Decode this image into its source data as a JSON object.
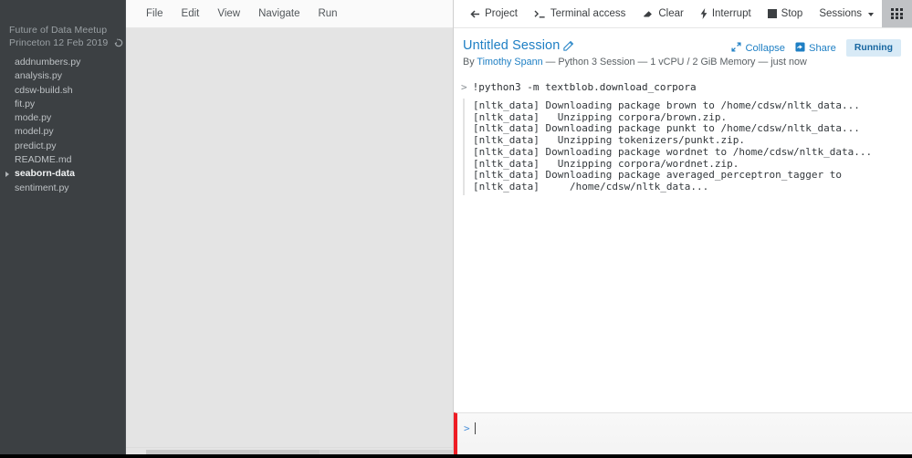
{
  "sidebar": {
    "project_title_line1": "Future of Data Meetup",
    "project_title_line2": "Princeton 12 Feb 2019",
    "refresh_icon": "refresh-icon",
    "files": [
      {
        "name": "addnumbers.py",
        "type": "file"
      },
      {
        "name": "analysis.py",
        "type": "file"
      },
      {
        "name": "cdsw-build.sh",
        "type": "file"
      },
      {
        "name": "fit.py",
        "type": "file"
      },
      {
        "name": "mode.py",
        "type": "file"
      },
      {
        "name": "model.py",
        "type": "file"
      },
      {
        "name": "predict.py",
        "type": "file"
      },
      {
        "name": "README.md",
        "type": "file"
      },
      {
        "name": "seaborn-data",
        "type": "folder"
      },
      {
        "name": "sentiment.py",
        "type": "file"
      }
    ]
  },
  "menubar": {
    "items": [
      {
        "label": "File"
      },
      {
        "label": "Edit"
      },
      {
        "label": "View"
      },
      {
        "label": "Navigate"
      },
      {
        "label": "Run"
      }
    ]
  },
  "toolbar": {
    "items": [
      {
        "label": "Project",
        "icon": "arrow-left-icon"
      },
      {
        "label": "Terminal access",
        "icon": "terminal-icon"
      },
      {
        "label": "Clear",
        "icon": "eraser-icon"
      },
      {
        "label": "Interrupt",
        "icon": "lightning-icon"
      },
      {
        "label": "Stop",
        "icon": "stop-square-icon"
      },
      {
        "label": "Sessions",
        "icon": "chevron-down-icon"
      }
    ],
    "apps_icon": "grid-apps-icon"
  },
  "session": {
    "title": "Untitled Session",
    "edit_icon": "pencil-edit-icon",
    "by_label": "By",
    "author": "Timothy Spann",
    "meta": "— Python 3 Session — 1 vCPU / 2 GiB Memory — just now",
    "collapse_label": "Collapse",
    "collapse_icon": "collapse-arrows-icon",
    "share_label": "Share",
    "share_icon": "share-icon",
    "status_badge": "Running",
    "accent_color": "#1e7fc4",
    "badge_bg": "#d8eaf6",
    "badge_fg": "#1766a0"
  },
  "console": {
    "prompt_symbol": ">",
    "command": "!python3 -m textblob.download_corpora",
    "output_lines": [
      "[nltk_data] Downloading package brown to /home/cdsw/nltk_data...",
      "[nltk_data]   Unzipping corpora/brown.zip.",
      "[nltk_data] Downloading package punkt to /home/cdsw/nltk_data...",
      "[nltk_data]   Unzipping tokenizers/punkt.zip.",
      "[nltk_data] Downloading package wordnet to /home/cdsw/nltk_data...",
      "[nltk_data]   Unzipping corpora/wordnet.zip.",
      "[nltk_data] Downloading package averaged_perceptron_tagger to",
      "[nltk_data]     /home/cdsw/nltk_data..."
    ]
  },
  "input": {
    "prompt_symbol": ">",
    "value": "",
    "placeholder": "",
    "marker_color": "#ee1c24"
  }
}
